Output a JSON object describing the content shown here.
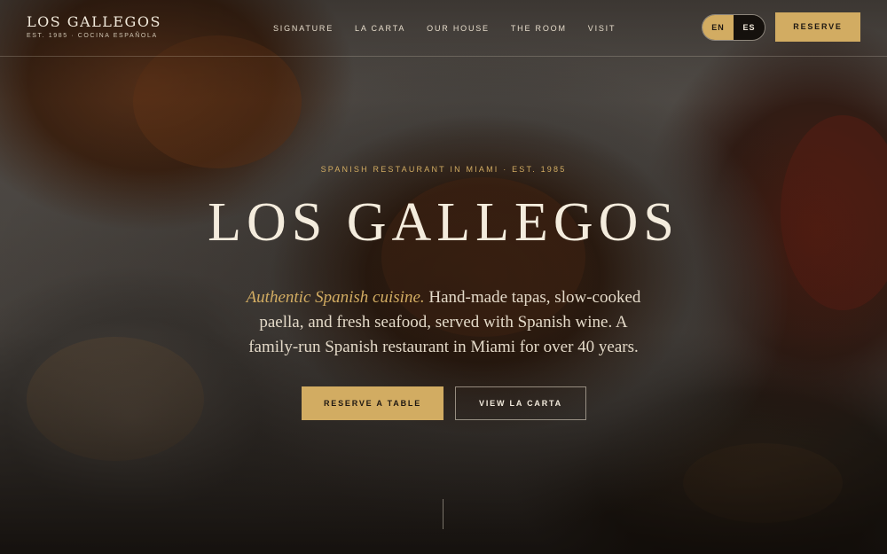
{
  "header": {
    "brand": "LOS GALLEGOS",
    "brand_sub": "EST. 1985 · COCINA ESPAÑOLA",
    "menu": [
      "SIGNATURE",
      "LA CARTA",
      "OUR HOUSE",
      "THE ROOM",
      "VISIT"
    ],
    "lang": {
      "en": "EN",
      "es": "ES",
      "active": "EN"
    },
    "reserve": "RESERVE"
  },
  "hero": {
    "kicker": "SPANISH RESTAURANT IN MIAMI · EST. 1985",
    "title": "LOS GALLEGOS",
    "desc_em": "Authentic Spanish cuisine.",
    "desc_rest": " Hand-made tapas, slow-cooked paella, and fresh seafood, served with Spanish wine. A family-run Spanish restaurant in Miami for over 40 years.",
    "cta_primary": "RESERVE A TABLE",
    "cta_secondary": "VIEW LA CARTA"
  },
  "colors": {
    "accent": "#d2ac62",
    "text_light": "#f4ecdd",
    "dark": "#15110d"
  }
}
